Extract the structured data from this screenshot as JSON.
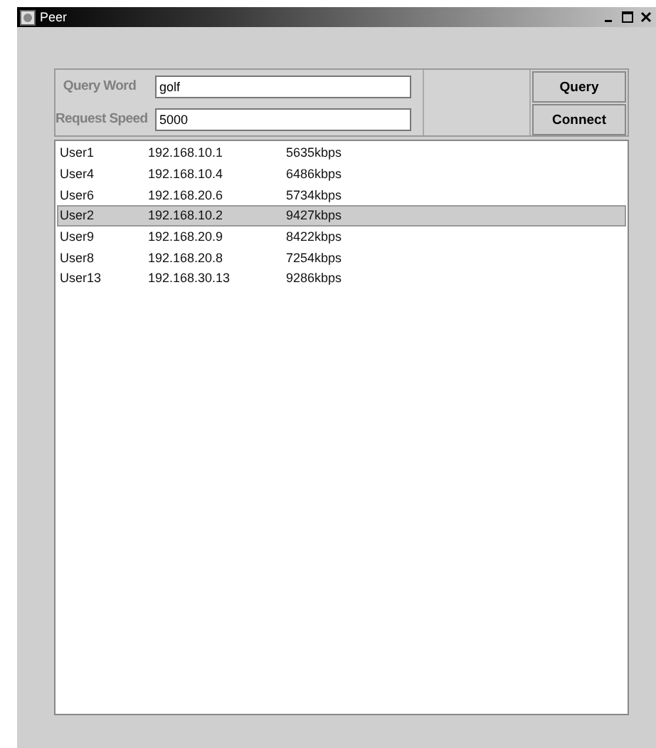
{
  "window": {
    "title": "Peer"
  },
  "form": {
    "fields": [
      {
        "label": "Query Word",
        "value": "golf"
      },
      {
        "label": "Request Speed",
        "value": "5000"
      }
    ],
    "buttons": [
      "Query",
      "Connect"
    ]
  },
  "list": {
    "rows": [
      {
        "cells": [
          "User1",
          "192.168.10.1",
          "5635kbps"
        ],
        "selected": false
      },
      {
        "cells": [
          "User4",
          "192.168.10.4",
          "6486kbps"
        ],
        "selected": false
      },
      {
        "cells": [
          "User6",
          "192.168.20.6",
          "5734kbps"
        ],
        "selected": false
      },
      {
        "cells": [
          "User2",
          "192.168.10.2",
          "9427kbps"
        ],
        "selected": true
      },
      {
        "cells": [
          "User9",
          "192.168.20.9",
          "8422kbps"
        ],
        "selected": false
      },
      {
        "cells": [
          "User8",
          "192.168.20.8",
          "7254kbps"
        ],
        "selected": false
      },
      {
        "cells": [
          "User13",
          "192.168.30.13",
          "9286kbps"
        ],
        "selected": false
      }
    ]
  }
}
